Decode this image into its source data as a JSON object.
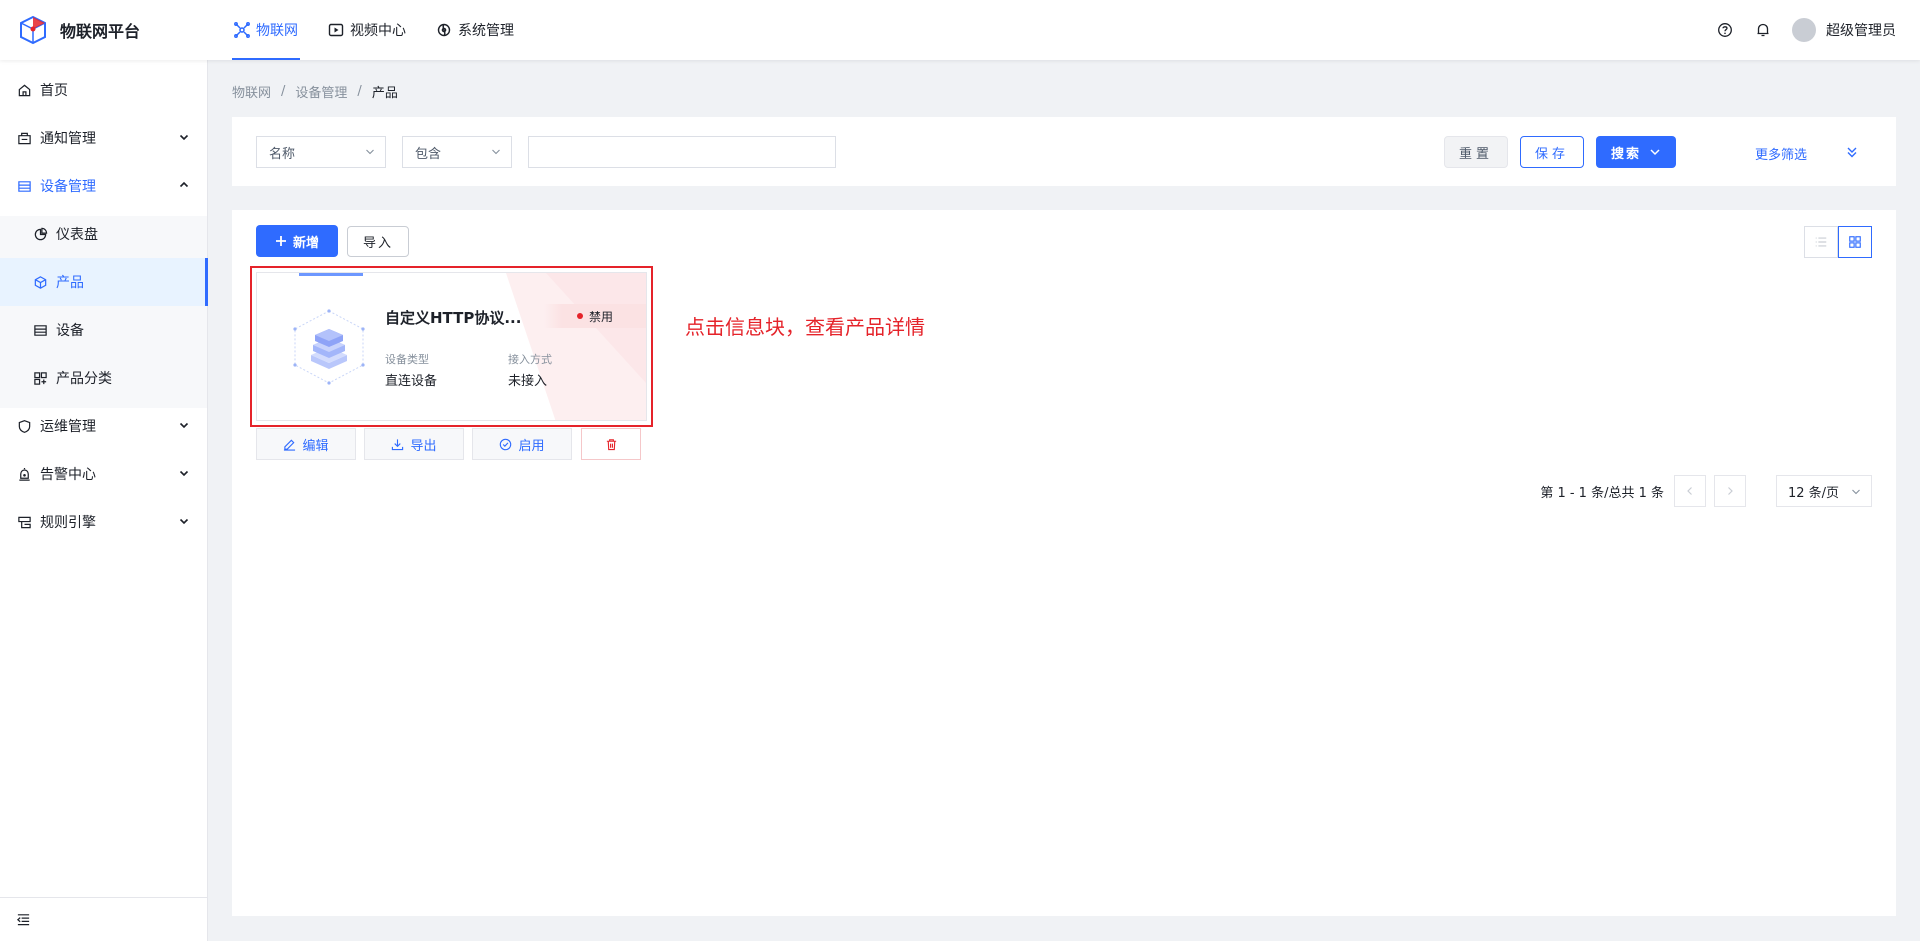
{
  "app": {
    "title": "物联网平台"
  },
  "topnav": {
    "items": [
      {
        "label": "物联网",
        "icon": "iot-icon",
        "active": true
      },
      {
        "label": "视频中心",
        "icon": "video-icon",
        "active": false
      },
      {
        "label": "系统管理",
        "icon": "system-icon",
        "active": false
      }
    ]
  },
  "user": {
    "name": "超级管理员"
  },
  "sidebar": {
    "items": [
      {
        "label": "首页",
        "icon": "home-icon"
      },
      {
        "label": "通知管理",
        "icon": "notification-icon"
      },
      {
        "label": "设备管理",
        "icon": "device-management-icon"
      },
      {
        "label": "仪表盘",
        "icon": "dashboard-icon"
      },
      {
        "label": "产品",
        "icon": "product-icon"
      },
      {
        "label": "设备",
        "icon": "device-icon"
      },
      {
        "label": "产品分类",
        "icon": "category-icon"
      },
      {
        "label": "运维管理",
        "icon": "operations-icon"
      },
      {
        "label": "告警中心",
        "icon": "alarm-icon"
      },
      {
        "label": "规则引擎",
        "icon": "rule-engine-icon"
      }
    ]
  },
  "breadcrumb": {
    "items": [
      "物联网",
      "设备管理",
      "产品"
    ]
  },
  "filter": {
    "field": "名称",
    "operator": "包含",
    "value": "",
    "reset_label": "重置",
    "save_label": "保存",
    "search_label": "搜索",
    "more_label": "更多筛选"
  },
  "toolbar": {
    "add_label": "新增",
    "import_label": "导入"
  },
  "card": {
    "title": "自定义HTTP协议...",
    "status": "禁用",
    "fields": [
      {
        "label": "设备类型",
        "value": "直连设备"
      },
      {
        "label": "接入方式",
        "value": "未接入"
      }
    ],
    "actions": {
      "edit": "编辑",
      "export": "导出",
      "enable": "启用"
    }
  },
  "annotation": "点击信息块，查看产品详情",
  "pagination": {
    "info": "第 1 - 1 条/总共 1 条",
    "page_size": "12 条/页"
  },
  "colors": {
    "primary": "#2f6bff",
    "danger": "#e5232a",
    "background": "#f0f2f5"
  }
}
